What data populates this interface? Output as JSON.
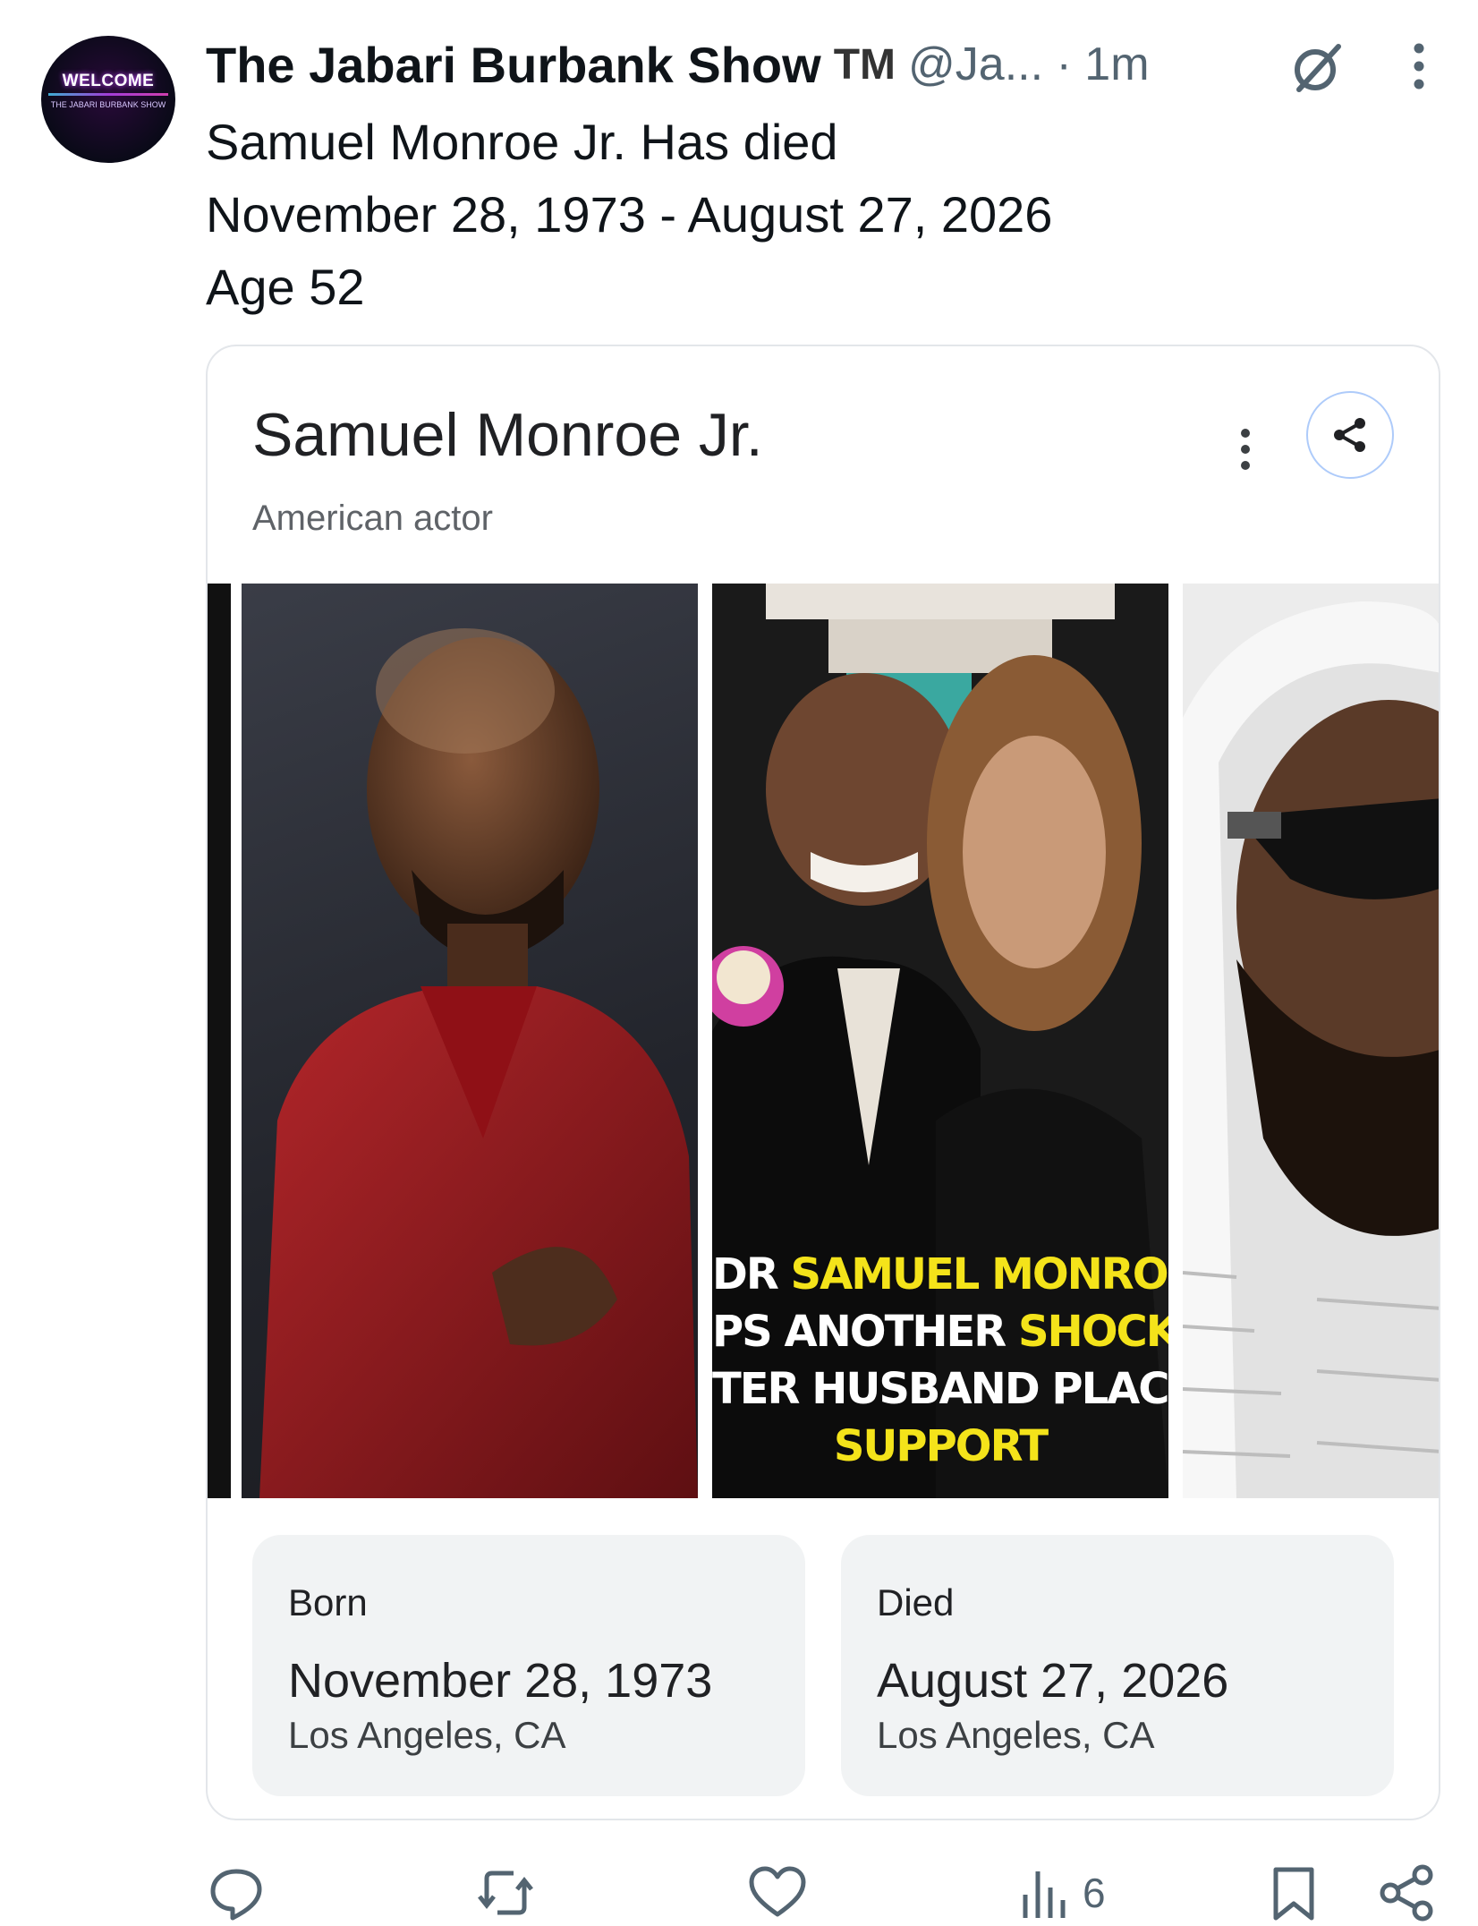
{
  "tweet": {
    "avatar": {
      "line1": "WELCOME",
      "line2": "THE JABARI BURBANK SHOW"
    },
    "author_name": "The Jabari Burbank Show",
    "badge": "TM",
    "handle_time": "@Ja... · 1m",
    "lines": [
      "Samuel Monroe Jr. Has died",
      "November 28, 1973 - August 27, 2026",
      "Age 52"
    ]
  },
  "card": {
    "title": "Samuel Monroe Jr.",
    "subtitle": "American actor",
    "image2_caption": {
      "line1_white": "DR ",
      "line1_yellow": "SAMUEL MONROE JR.'S",
      "line2_white": "PS ANOTHER ",
      "line2_yellow": "SHOCKING UP",
      "line3_white": "TER HUSBAND PLACED ON",
      "line4_yellow": "SUPPORT"
    },
    "born": {
      "label": "Born",
      "date": "November 28, 1973",
      "place": "Los Angeles, CA"
    },
    "died": {
      "label": "Died",
      "date": "August 27, 2026",
      "place": "Los Angeles, CA"
    }
  },
  "actions": {
    "views": "6"
  },
  "colors": {
    "accent_blue": "#aecbfa",
    "muted": "#536471",
    "caption_yellow": "#f4e31a"
  }
}
